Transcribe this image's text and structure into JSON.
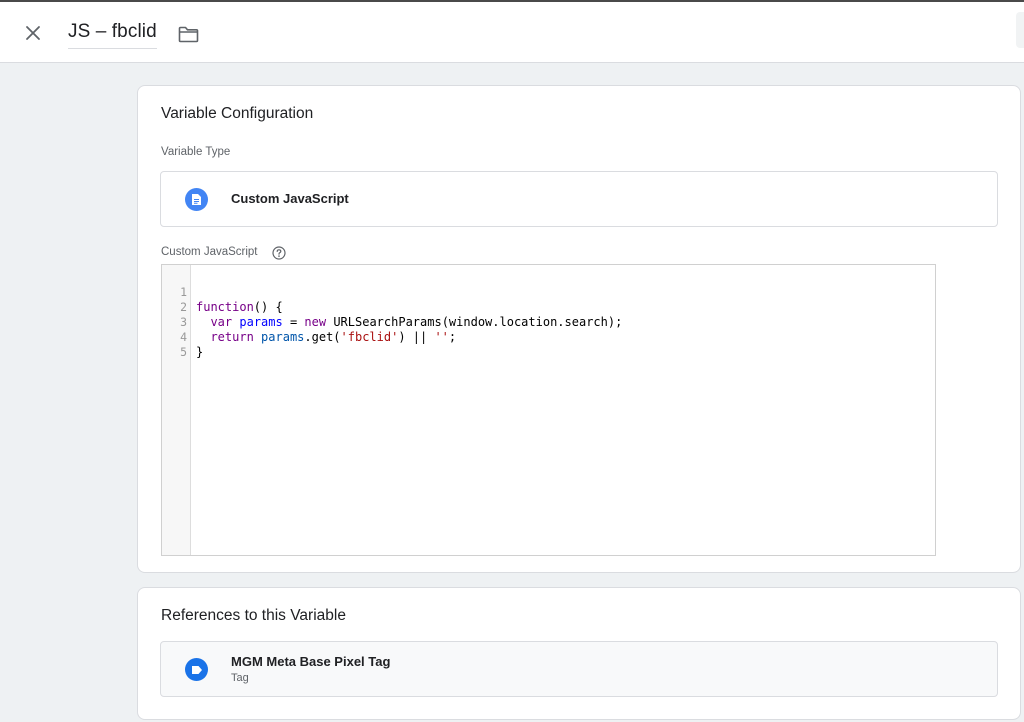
{
  "header": {
    "title": "JS – fbclid",
    "close_icon": "close-icon",
    "folder_icon": "folder-icon"
  },
  "config": {
    "card_title": "Variable Configuration",
    "type_label": "Variable Type",
    "type_name": "Custom JavaScript",
    "type_icon": "document-icon",
    "type_icon_color": "#4285f4",
    "code_label": "Custom JavaScript",
    "help_icon": "help-icon",
    "code_lines": [
      "function() {",
      "  var params = new URLSearchParams(window.location.search);",
      "  return params.get('fbclid') || '';",
      "}",
      ""
    ],
    "line_numbers": [
      "1",
      "2",
      "3",
      "4",
      "5"
    ]
  },
  "references": {
    "card_title": "References to this Variable",
    "items": [
      {
        "name": "MGM Meta Base Pixel Tag",
        "type": "Tag",
        "icon": "tag-icon",
        "icon_color": "#1a73e8"
      }
    ]
  }
}
